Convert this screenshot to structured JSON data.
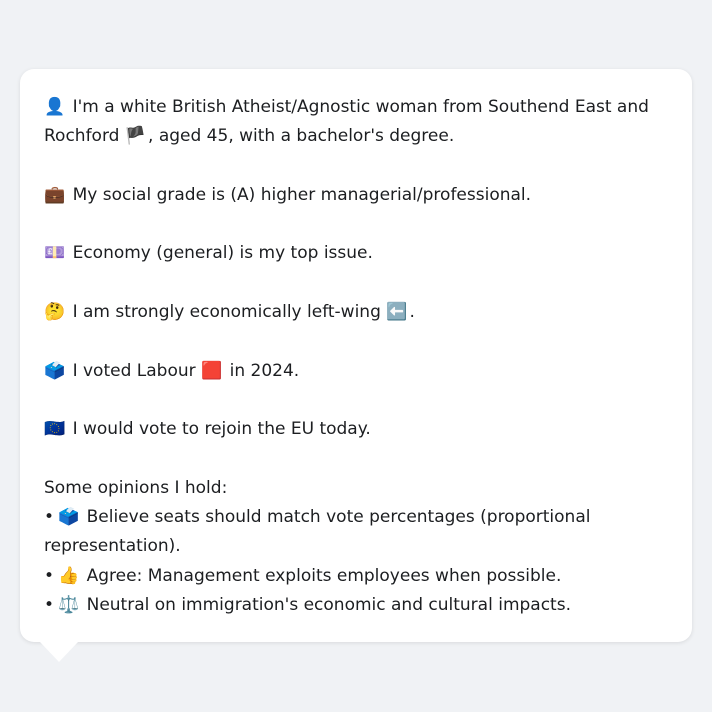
{
  "profile": {
    "identity": {
      "emoji": "👤",
      "text_a": "I'm a white British Atheist/Agnostic woman from Southend East and Rochford",
      "flag": "🏴",
      "text_b": ", aged 45, with a bachelor's degree."
    },
    "social_grade": {
      "emoji": "💼",
      "text": "My social grade is (A) higher managerial/professional."
    },
    "top_issue": {
      "emoji": "💷",
      "text": "Economy (general) is my top issue."
    },
    "economic_position": {
      "emoji": "🤔",
      "text_a": "I am strongly economically left-wing",
      "arrow": "⬅️",
      "text_b": "."
    },
    "vote_2024": {
      "emoji": "🗳️",
      "text_a": "I voted Labour",
      "party_icon": "🟥",
      "text_b": "in 2024."
    },
    "eu": {
      "emoji": "🇪🇺",
      "text": "I would vote to rejoin the EU today."
    }
  },
  "opinions": {
    "heading": "Some opinions I hold:",
    "bullet": "•",
    "items": [
      {
        "emoji": "🗳️",
        "text": "Believe seats should match vote percentages (proportional representation)."
      },
      {
        "emoji": "👍",
        "text": "Agree: Management exploits employees when possible."
      },
      {
        "emoji": "⚖️",
        "text": "Neutral on immigration's economic and cultural impacts."
      }
    ]
  }
}
